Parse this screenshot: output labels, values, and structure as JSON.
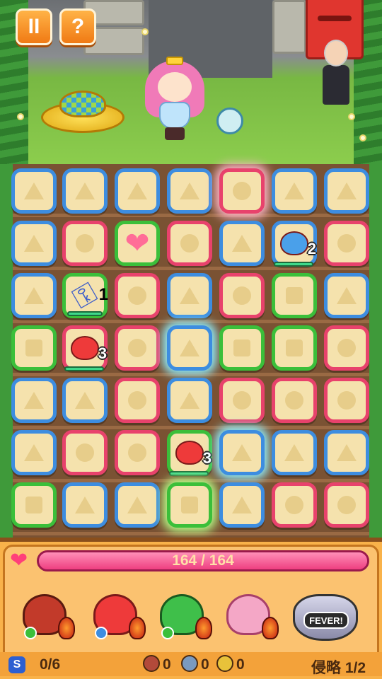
{
  "top": {
    "pause_label": "II",
    "help_label": "?"
  },
  "board": {
    "rows": [
      [
        "blue-triangle",
        "blue-triangle",
        "blue-triangle",
        "blue-triangle",
        "pink-circle-glow",
        "blue-triangle",
        "blue-triangle"
      ],
      [
        "blue-triangle",
        "pink-circle",
        "green-heart",
        "pink-circle",
        "blue-triangle",
        "blue-unit",
        "pink-circle"
      ],
      [
        "blue-triangle",
        "green-key",
        "pink-circle",
        "blue-triangle",
        "pink-circle",
        "green-square",
        "blue-triangle"
      ],
      [
        "green-square",
        "pink-unit",
        "pink-circle",
        "blue-triangle-glow",
        "green-square",
        "green-square",
        "pink-circle"
      ],
      [
        "blue-triangle",
        "blue-triangle",
        "pink-circle",
        "blue-triangle",
        "pink-circle",
        "pink-circle",
        "pink-circle"
      ],
      [
        "blue-triangle",
        "pink-circle",
        "pink-circle",
        "green-unit",
        "blue-triangle-glow",
        "blue-triangle",
        "blue-triangle"
      ],
      [
        "green-square",
        "blue-triangle",
        "blue-triangle",
        "green-square-glow",
        "blue-triangle",
        "pink-circle",
        "pink-circle"
      ]
    ],
    "unit_counts": {
      "blue_penguin": "2",
      "key": "1",
      "red_bird_left": "3",
      "red_bird_bottom": "3"
    }
  },
  "status": {
    "hp_text": "164 / 164",
    "hp_fraction": 1.0,
    "score_label": "0/6",
    "item1_count": "0",
    "item2_count": "0",
    "item3_count": "0",
    "progress_label": "侵略 1/2",
    "fever_label": "FEVER!",
    "s_icon_label": "S"
  },
  "colors": {
    "blue": "#3d8de0",
    "pink": "#e8426c",
    "green": "#3bbf3a",
    "hp_bar": "#f13d80"
  },
  "icons": [
    "pause-icon",
    "help-icon",
    "heart-icon",
    "key-icon",
    "s-icon",
    "fever-pot-icon"
  ]
}
